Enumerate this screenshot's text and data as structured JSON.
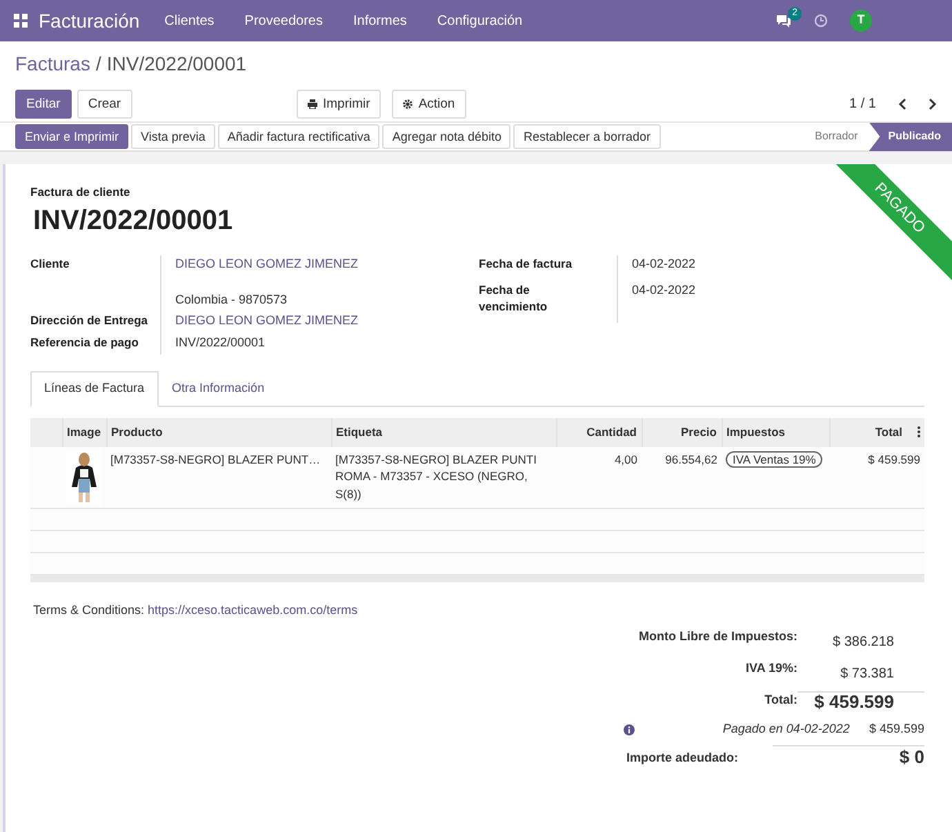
{
  "app": {
    "title": "Facturación",
    "menu": [
      "Clientes",
      "Proveedores",
      "Informes",
      "Configuración"
    ],
    "messages_count": "2",
    "avatar_initial": "T"
  },
  "breadcrumb": {
    "parent": "Facturas",
    "separator": "/",
    "current": "INV/2022/00001"
  },
  "main_buttons": [
    {
      "label": "Editar",
      "kind": "primary"
    },
    {
      "label": "Crear",
      "kind": "secondary"
    }
  ],
  "action_buttons": [
    {
      "label": "Imprimir",
      "kind": "print"
    },
    {
      "label": "Action",
      "kind": "gear"
    }
  ],
  "pager": "1 / 1",
  "status_actions": [
    {
      "label": "Enviar e Imprimir",
      "kind": "primary"
    },
    {
      "label": "Vista previa",
      "kind": "secondary"
    },
    {
      "label": "Añadir factura rectificativa",
      "kind": "secondary"
    },
    {
      "label": "Agregar nota débito",
      "kind": "secondary"
    },
    {
      "label": "Restablecer a borrador",
      "kind": "secondary"
    }
  ],
  "stages": [
    {
      "label": "Borrador",
      "selected": false
    },
    {
      "label": "Publicado",
      "selected": true
    }
  ],
  "ribbon": "PAGADO",
  "form": {
    "subtitle": "Factura de cliente",
    "number": "INV/2022/00001",
    "left_fields": [
      {
        "label": "Cliente",
        "lines": [
          {
            "text": "DIEGO LEON GOMEZ JIMENEZ",
            "kind": "link"
          },
          {
            "text": "Colombia - 9870573",
            "kind": "text"
          }
        ]
      },
      {
        "label": "Dirección de Entrega",
        "lines": [
          {
            "text": "DIEGO LEON GOMEZ JIMENEZ",
            "kind": "link"
          }
        ]
      },
      {
        "label": "Referencia de pago",
        "lines": [
          {
            "text": "INV/2022/00001",
            "kind": "text"
          }
        ]
      }
    ],
    "right_fields": [
      {
        "label": "Fecha de factura",
        "value": "04-02-2022"
      },
      {
        "label": "Fecha de vencimiento",
        "value": "04-02-2022"
      }
    ]
  },
  "tabs": [
    {
      "label": "Líneas de Factura",
      "selected": true
    },
    {
      "label": "Otra Información",
      "selected": false
    }
  ],
  "table": {
    "columns": [
      "Image",
      "Producto",
      "Etiqueta",
      "Cantidad",
      "Precio",
      "Impuestos",
      "Total"
    ],
    "rows": [
      {
        "product": "[M73357-S8-NEGRO] BLAZER PUNT…",
        "label": "[M73357-S8-NEGRO] BLAZER PUNTI ROMA - M73357 - XCESO (NEGRO, S(8))",
        "quantity": "4,00",
        "price": "96.554,62",
        "tax": "IVA Ventas 19%",
        "total": "$ 459.599"
      }
    ]
  },
  "terms": {
    "label": "Terms & Conditions:",
    "url": "https://xceso.tacticaweb.com.co/terms"
  },
  "totals": [
    {
      "label": "Monto Libre de Impuestos:",
      "value": "$ 386.218",
      "kind": "normal"
    },
    {
      "label": "IVA 19%:",
      "value": "$ 73.381",
      "kind": "normal"
    },
    {
      "label": "Total:",
      "value": "$ 459.599",
      "kind": "grand"
    }
  ],
  "payment": {
    "label": "Pagado en 04-02-2022",
    "amount": "$ 459.599"
  },
  "amount_due": {
    "label": "Importe adeudado:",
    "value": "$ 0"
  }
}
